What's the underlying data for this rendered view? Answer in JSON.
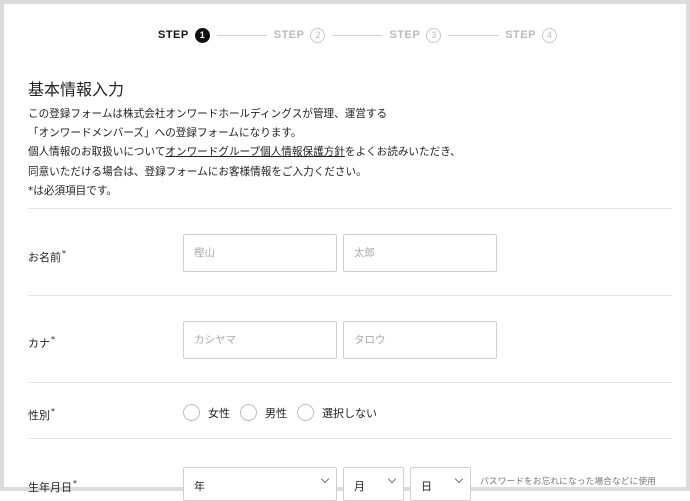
{
  "steps": [
    {
      "label": "STEP",
      "number": "1",
      "active": true
    },
    {
      "label": "STEP",
      "number": "2",
      "active": false
    },
    {
      "label": "STEP",
      "number": "3",
      "active": false
    },
    {
      "label": "STEP",
      "number": "4",
      "active": false
    }
  ],
  "title": "基本情報入力",
  "intro": {
    "line1": "この登録フォームは株式会社オンワードホールディングスが管理、運営する",
    "line2": "「オンワードメンバーズ」への登録フォームになります。",
    "line3_before": "個人情報のお取扱いについて",
    "line3_link": "オンワードグループ個人情報保護方針",
    "line3_after": "をよくお読みいただき、",
    "line4": "同意いただける場合は、登録フォームにお客様情報をご入力ください。",
    "line5": "*は必須項目です。"
  },
  "fields": {
    "name": {
      "label": "お名前",
      "required": "*",
      "last_placeholder": "樫山",
      "first_placeholder": "太郎"
    },
    "kana": {
      "label": "カナ",
      "required": "*",
      "last_placeholder": "カシヤマ",
      "first_placeholder": "タロウ"
    },
    "gender": {
      "label": "性別",
      "required": "*",
      "options": [
        "女性",
        "男性",
        "選択しない"
      ]
    },
    "birthday": {
      "label": "生年月日",
      "required": "*",
      "year": "年",
      "month": "月",
      "day": "日",
      "hint": "パスワードをお忘れになった場合などに使用"
    }
  }
}
